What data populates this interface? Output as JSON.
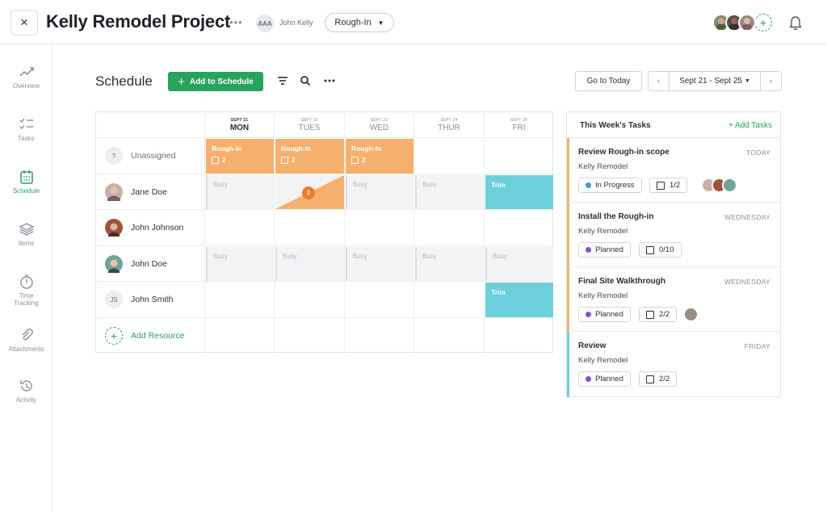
{
  "header": {
    "close_label": "×",
    "project_title": "Kelly Remodel Project",
    "more_label": "•••",
    "owner_initials": "AAA",
    "owner_name": "John Kelly",
    "phase": "Rough-In",
    "bell_icon": "bell-icon"
  },
  "sidebar": {
    "items": [
      {
        "label": "Overview",
        "icon": "trend-icon"
      },
      {
        "label": "Tasks",
        "icon": "checklist-icon"
      },
      {
        "label": "Schedule",
        "icon": "calendar-icon"
      },
      {
        "label": "Items",
        "icon": "layers-icon"
      },
      {
        "label": "Time Tracking",
        "icon": "stopwatch-icon"
      },
      {
        "label": "Attachments",
        "icon": "paperclip-icon"
      },
      {
        "label": "Activity",
        "icon": "history-icon"
      }
    ]
  },
  "toolbar": {
    "title": "Schedule",
    "add_label": "Add to Schedule",
    "goto_today": "Go to Today",
    "range_label": "Sept 21 - Sept 25"
  },
  "days": [
    {
      "date": "SEPT 21",
      "name": "MON"
    },
    {
      "date": "SEPT 22",
      "name": "TUES"
    },
    {
      "date": "SEPT 23",
      "name": "WED"
    },
    {
      "date": "SEPT 24",
      "name": "THUR"
    },
    {
      "date": "SEPT 25",
      "name": "FRI"
    }
  ],
  "resources": [
    {
      "name": "Unassigned",
      "initials": "?"
    },
    {
      "name": "Jane Doe"
    },
    {
      "name": "John Johnson"
    },
    {
      "name": "John Doe"
    },
    {
      "name": "John Smith",
      "initials": "JS"
    }
  ],
  "add_resource_label": "Add Resource",
  "blocks": {
    "rough_in_label": "Rough-In",
    "rough_in_count": "2",
    "busy_label": "Busy",
    "trim_label": "Trim",
    "overlap_count": "2"
  },
  "tasks_panel": {
    "title": "This Week's Tasks",
    "add_label": "+ Add Tasks",
    "tasks": [
      {
        "name": "Review Rough-in scope",
        "when": "TODAY",
        "project": "Kelly Remodel",
        "status": "In Progress",
        "status_color": "#3aa0d6",
        "checklist": "1/2"
      },
      {
        "name": "Install the Rough-in",
        "when": "WEDNESDAY",
        "project": "Kelly Remodel",
        "status": "Planned",
        "status_color": "#8b4fc4",
        "checklist": "0/10"
      },
      {
        "name": "Final Site Walkthrough",
        "when": "WEDNESDAY",
        "project": "Kelly Remodel",
        "status": "Planned",
        "status_color": "#8b4fc4",
        "checklist": "2/2"
      },
      {
        "name": "Review",
        "when": "FRIDAY",
        "project": "Kelly Remodel",
        "status": "Planned",
        "status_color": "#8b4fc4",
        "checklist": "2/2"
      }
    ]
  },
  "colors": {
    "brand_green": "#27a35d",
    "rough_in_orange": "#f5b06d",
    "trim_teal": "#6dcfdc",
    "overlap_orange": "#ef7b2b"
  }
}
